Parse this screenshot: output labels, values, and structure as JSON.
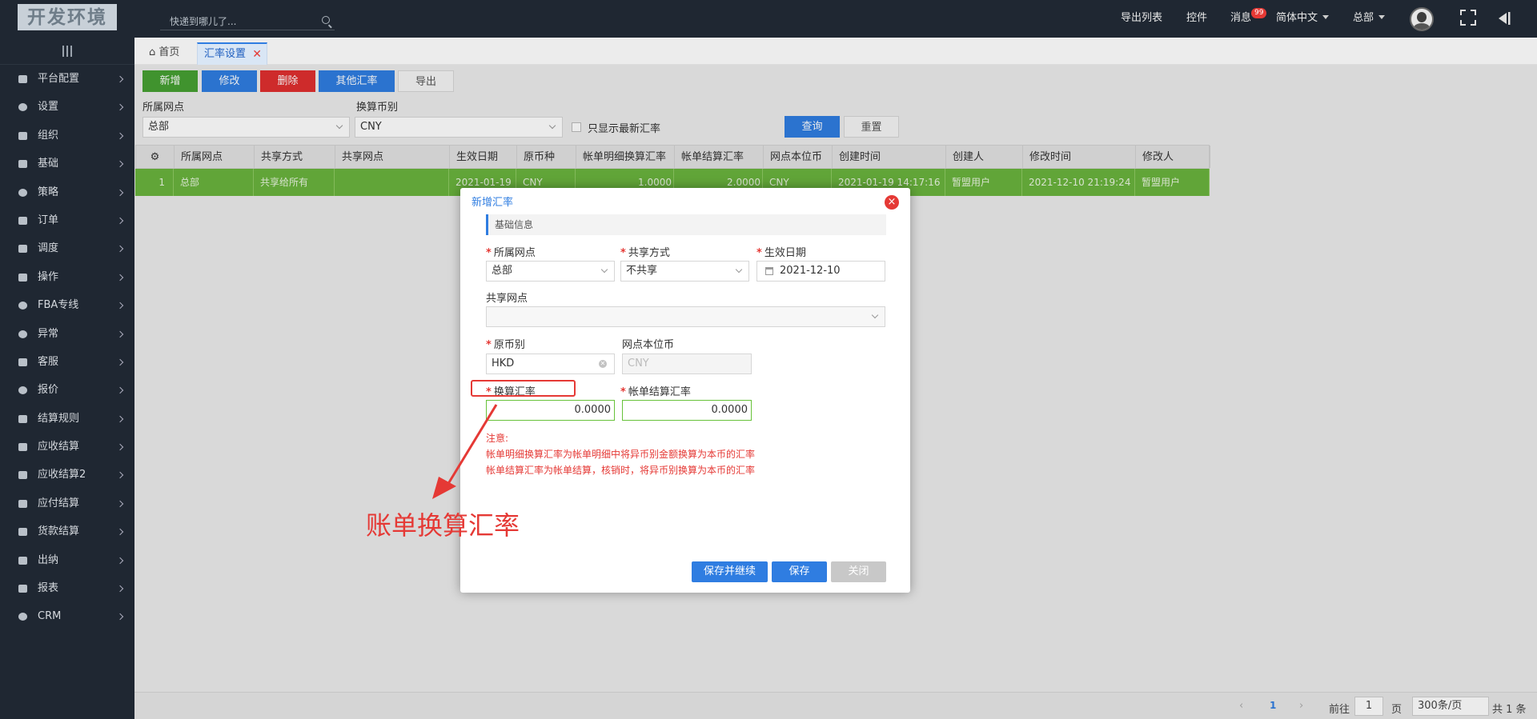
{
  "topbar": {
    "logo": "开发环境",
    "search_placeholder": "快递到哪儿了...",
    "nav": [
      "导出列表",
      "控件",
      "消息",
      "简体中文",
      "总部"
    ],
    "message_badge": "99"
  },
  "sidebar": {
    "items": [
      "平台配置",
      "设置",
      "组织",
      "基础",
      "策略",
      "订单",
      "调度",
      "操作",
      "FBA专线",
      "异常",
      "客服",
      "报价",
      "结算规则",
      "应收结算",
      "应收结算2",
      "应付结算",
      "货款结算",
      "出纳",
      "报表",
      "CRM"
    ]
  },
  "tabs": {
    "home": "首页",
    "active": "汇率设置"
  },
  "toolbar": {
    "add": "新增",
    "edit": "修改",
    "delete": "删除",
    "other_rates": "其他汇率",
    "export": "导出"
  },
  "filters": {
    "outlet_label": "所属网点",
    "outlet_value": "总部",
    "currency_label": "换算币别",
    "currency_value": "CNY",
    "latest_only": "只显示最新汇率",
    "query": "查询",
    "reset": "重置"
  },
  "grid": {
    "headers": [
      "所属网点",
      "共享方式",
      "共享网点",
      "生效日期",
      "原币种",
      "帐单明细换算汇率",
      "帐单结算汇率",
      "网点本位币",
      "创建时间",
      "创建人",
      "修改时间",
      "修改人"
    ],
    "rows": [
      [
        "1",
        "总部",
        "共享给所有",
        "",
        "2021-01-19",
        "CNY",
        "1.0000",
        "2.0000",
        "CNY",
        "2021-01-19 14:17:16",
        "暂盟用户",
        "2021-12-10 21:19:24",
        "暂盟用户"
      ]
    ]
  },
  "modal": {
    "title": "新增汇率",
    "close": "×",
    "section": "基础信息",
    "outlet_label": "所属网点",
    "outlet_value": "总部",
    "share_label": "共享方式",
    "share_value": "不共享",
    "date_label": "生效日期",
    "date_value": "2021-12-10",
    "share_outlet_label": "共享网点",
    "share_outlet_value": "",
    "orig_currency_label": "原币别",
    "orig_currency_value": "HKD",
    "base_currency_label": "网点本位币",
    "base_currency_value": "CNY",
    "conv_rate_label": "换算汇率",
    "conv_rate_value": "0.0000",
    "settle_rate_label": "帐单结算汇率",
    "settle_rate_value": "0.0000",
    "note_title": "注意:",
    "note_line1": "帐单明细换算汇率为帐单明细中将异币别金额换算为本币的汇率",
    "note_line2": "帐单结算汇率为帐单结算，核销时，将异币别换算为本币的汇率",
    "save_continue": "保存并继续",
    "save": "保存",
    "close_btn": "关闭"
  },
  "annotation": {
    "callout": "账单换算汇率"
  },
  "footer": {
    "page": "1",
    "goto_label": "前往",
    "goto_value": "1",
    "page_unit": "页",
    "page_size": "300条/页",
    "total": "共 1 条"
  },
  "colors": {
    "topbar": "#1f2732",
    "primary": "#2f7de1",
    "danger": "#e53935",
    "success": "#46a032",
    "row_selected": "#6ab43d"
  }
}
